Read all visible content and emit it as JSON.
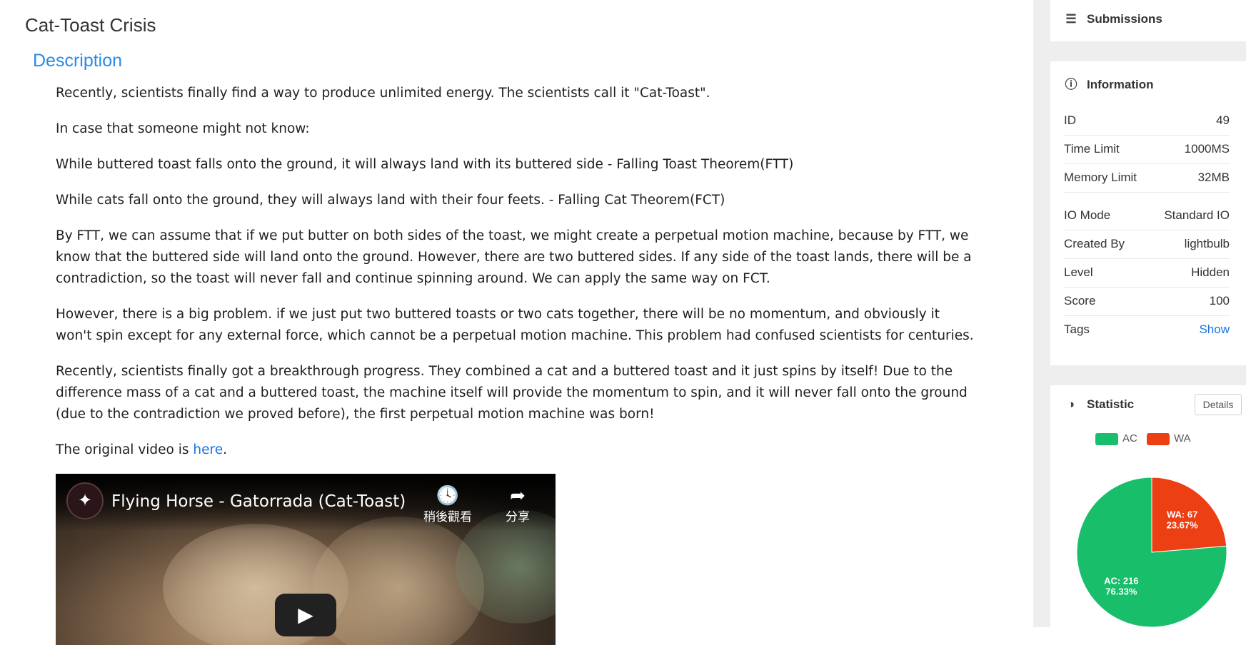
{
  "problem": {
    "title": "Cat-Toast Crisis",
    "section": "Description",
    "paragraphs": [
      "Recently, scientists finally find a way to produce unlimited energy. The scientists call it \"Cat-Toast\".",
      "In case that someone might not know:",
      "While buttered toast falls onto the ground, it will always land with its buttered side - Falling Toast Theorem(FTT)",
      "While cats fall onto the ground, they will always land with their four feets. - Falling Cat Theorem(FCT)",
      "By FTT, we can assume that if we put butter on both sides of the toast, we might create a perpetual motion machine, because by FTT, we know that the buttered side will land onto the ground. However, there are two buttered sides. If any side of the toast lands, there will be a contradiction, so the toast will never fall and continue spinning around. We can apply the same way on FCT.",
      "However, there is a big problem. if we just put two buttered toasts or two cats together, there will be no momentum, and obviously it won't spin except for any external force, which cannot be a perpetual motion machine. This problem had confused scientists for centuries.",
      "Recently, scientists finally got a breakthrough progress. They combined a cat and a buttered toast and it just spins by itself! Due to the difference mass of a cat and a buttered toast, the machine itself will provide the momentum to spin, and it will never fall onto the ground (due to the contradiction we proved before), the first perpetual motion machine was born!"
    ],
    "video_line_prefix": "The original video is ",
    "video_link_text": "here",
    "video_line_suffix": "."
  },
  "video": {
    "title": "Flying Horse - Gatorrada (Cat-Toast)",
    "watch_later_label": "稍後觀看",
    "share_label": "分享",
    "logo_icon": "pegasus-logo",
    "play_icon": "play-icon"
  },
  "sidebar": {
    "submissions_label": "Submissions",
    "information": {
      "title": "Information",
      "rows": [
        {
          "key": "ID",
          "value": "49"
        },
        {
          "key": "Time Limit",
          "value": "1000MS"
        },
        {
          "key": "Memory Limit",
          "value": "32MB"
        },
        {
          "key": "IO Mode",
          "value": "Standard IO"
        },
        {
          "key": "Created By",
          "value": "lightbulb"
        },
        {
          "key": "Level",
          "value": "Hidden"
        },
        {
          "key": "Score",
          "value": "100"
        },
        {
          "key": "Tags",
          "value": "Show"
        }
      ]
    },
    "statistic": {
      "title": "Statistic",
      "details_label": "Details"
    }
  },
  "chart_data": {
    "type": "pie",
    "categories": [
      "AC",
      "WA"
    ],
    "values": [
      216,
      67
    ],
    "percent_labels": [
      "76.33%",
      "23.67%"
    ],
    "data_labels": [
      "AC: 216",
      "WA: 67"
    ],
    "colors": [
      "#19be6b",
      "#ed3f14"
    ],
    "legend": "top"
  }
}
